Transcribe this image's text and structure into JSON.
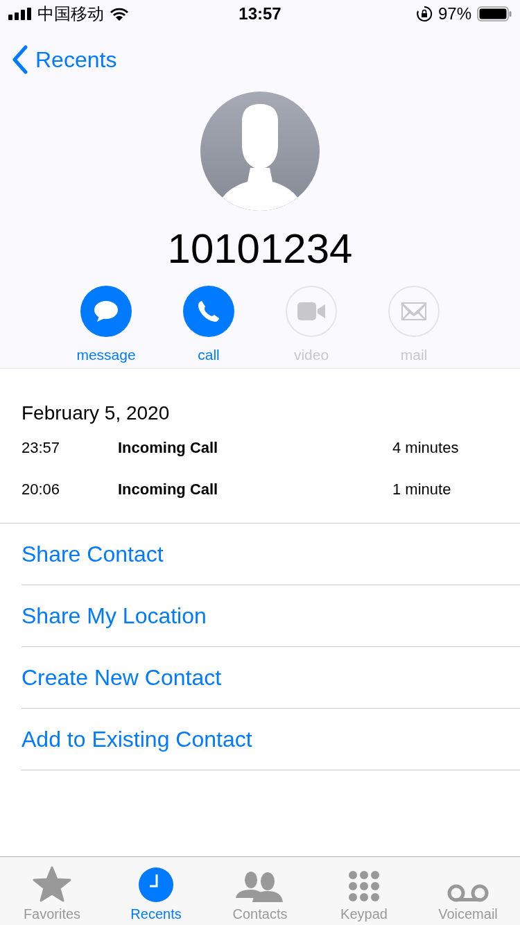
{
  "status_bar": {
    "carrier": "中国移动",
    "time": "13:57",
    "battery": "97%"
  },
  "nav": {
    "back": "Recents"
  },
  "contact": {
    "number": "10101234"
  },
  "actions": [
    {
      "kind": "message",
      "label": "message",
      "disabled": false
    },
    {
      "kind": "call",
      "label": "call",
      "disabled": false
    },
    {
      "kind": "video",
      "label": "video",
      "disabled": true
    },
    {
      "kind": "mail",
      "label": "mail",
      "disabled": true
    }
  ],
  "history": {
    "date": "February 5, 2020",
    "calls": [
      {
        "time": "23:57",
        "type": "Incoming Call",
        "duration": "4 minutes"
      },
      {
        "time": "20:06",
        "type": "Incoming Call",
        "duration": "1 minute"
      }
    ]
  },
  "options": [
    "Share Contact",
    "Share My Location",
    "Create New Contact",
    "Add to Existing Contact"
  ],
  "tabs": [
    {
      "kind": "favorites",
      "label": "Favorites",
      "selected": false
    },
    {
      "kind": "recents",
      "label": "Recents",
      "selected": true
    },
    {
      "kind": "contacts",
      "label": "Contacts",
      "selected": false
    },
    {
      "kind": "keypad",
      "label": "Keypad",
      "selected": false
    },
    {
      "kind": "voicemail",
      "label": "Voicemail",
      "selected": false
    }
  ]
}
